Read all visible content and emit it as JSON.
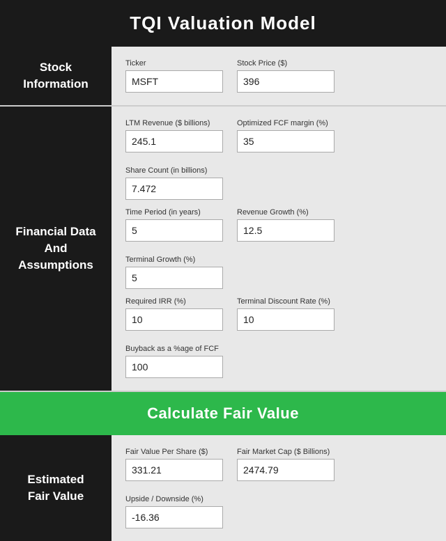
{
  "header": {
    "title": "TQI Valuation Model"
  },
  "stock_information": {
    "label": "Stock\nInformation",
    "fields": [
      {
        "label": "Ticker",
        "value": "MSFT",
        "id": "ticker"
      },
      {
        "label": "Stock Price ($)",
        "value": "396",
        "id": "stock-price"
      }
    ]
  },
  "financial_data": {
    "label": "Financial Data\nAnd\nAssumptions",
    "rows": [
      [
        {
          "label": "LTM Revenue ($ billions)",
          "value": "245.1",
          "id": "ltm-revenue"
        },
        {
          "label": "Optimized FCF margin (%)",
          "value": "35",
          "id": "fcf-margin"
        },
        {
          "label": "Share Count (in billions)",
          "value": "7.472",
          "id": "share-count"
        }
      ],
      [
        {
          "label": "Time Period (in years)",
          "value": "5",
          "id": "time-period"
        },
        {
          "label": "Revenue Growth (%)",
          "value": "12.5",
          "id": "revenue-growth"
        },
        {
          "label": "Terminal Growth (%)",
          "value": "5",
          "id": "terminal-growth"
        }
      ],
      [
        {
          "label": "Required IRR (%)",
          "value": "10",
          "id": "required-irr"
        },
        {
          "label": "Terminal Discount Rate (%)",
          "value": "10",
          "id": "terminal-discount"
        },
        {
          "label": "Buyback as a %age of FCF",
          "value": "100",
          "id": "buyback"
        }
      ]
    ]
  },
  "calculate_button": {
    "label": "Calculate Fair Value"
  },
  "estimated_fair_value": {
    "label": "Estimated\nFair Value",
    "fields": [
      {
        "label": "Fair Value Per Share ($)",
        "value": "331.21",
        "id": "fair-value-per-share"
      },
      {
        "label": "Fair Market Cap ($ Billions)",
        "value": "2474.79",
        "id": "fair-market-cap"
      },
      {
        "label": "Upside / Downside (%)",
        "value": "-16.36",
        "id": "upside-downside"
      }
    ]
  }
}
